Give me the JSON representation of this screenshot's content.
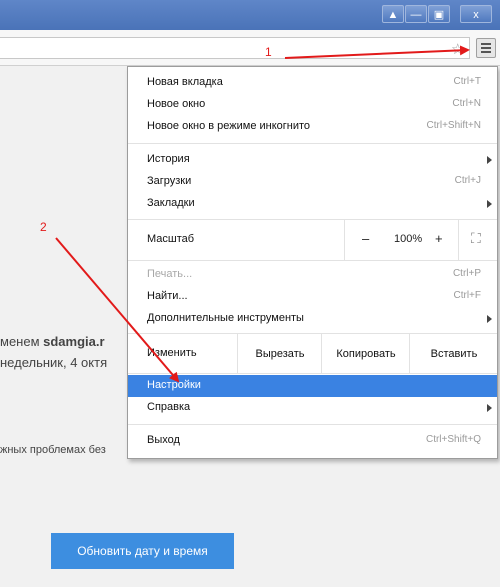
{
  "window": {
    "buttons": [
      "▲",
      "—",
      "▣",
      "x"
    ]
  },
  "toolbar": {
    "star_icon": "☆"
  },
  "page": {
    "line1_prefix": "менем ",
    "line1_bold": "sdamgia.r",
    "line2": "недельник, 4 октя",
    "line3": "жных проблемах без",
    "update_button": "Обновить дату и время"
  },
  "menu": {
    "new_tab": {
      "label": "Новая вкладка",
      "shortcut": "Ctrl+T"
    },
    "new_window": {
      "label": "Новое окно",
      "shortcut": "Ctrl+N"
    },
    "incognito": {
      "label": "Новое окно в режиме инкогнито",
      "shortcut": "Ctrl+Shift+N"
    },
    "history": {
      "label": "История"
    },
    "downloads": {
      "label": "Загрузки",
      "shortcut": "Ctrl+J"
    },
    "bookmarks": {
      "label": "Закладки"
    },
    "zoom": {
      "label": "Масштаб",
      "minus": "–",
      "value": "100%",
      "plus": "+",
      "fullscreen": "⛶"
    },
    "print": {
      "label": "Печать...",
      "shortcut": "Ctrl+P"
    },
    "find": {
      "label": "Найти...",
      "shortcut": "Ctrl+F"
    },
    "more_tools": {
      "label": "Дополнительные инструменты"
    },
    "edit": {
      "label": "Изменить",
      "cut": "Вырезать",
      "copy": "Копировать",
      "paste": "Вставить"
    },
    "settings": {
      "label": "Настройки"
    },
    "help": {
      "label": "Справка"
    },
    "exit": {
      "label": "Выход",
      "shortcut": "Ctrl+Shift+Q"
    }
  },
  "annotations": {
    "one": "1",
    "two": "2",
    "color": "#e21a1a"
  }
}
